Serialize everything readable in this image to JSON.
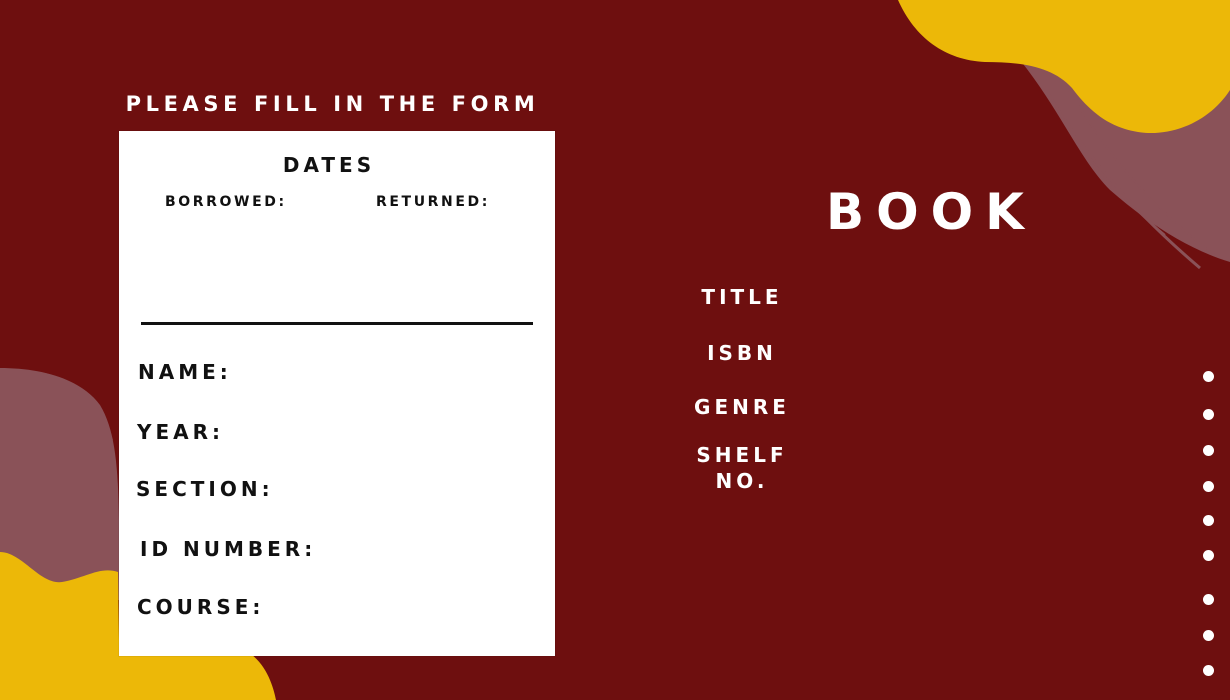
{
  "form": {
    "header": "PLEASE FILL IN THE FORM",
    "dates_title": "DATES",
    "borrowed_label": "BORROWED:",
    "returned_label": "RETURNED:",
    "fields": {
      "name": "NAME:",
      "year": "YEAR:",
      "section": "SECTION:",
      "id_number": "ID NUMBER:",
      "course": "COURSE:"
    }
  },
  "book": {
    "title": "BOOK",
    "fields": {
      "title": "TITLE",
      "isbn": "ISBN",
      "genre": "GENRE",
      "shelf_no": "SHELF\nNO."
    }
  },
  "colors": {
    "background": "#6e0f0f",
    "accent_yellow": "#ecb808",
    "accent_mauve": "#8a5258",
    "card": "#ffffff",
    "text_dark": "#111111"
  }
}
